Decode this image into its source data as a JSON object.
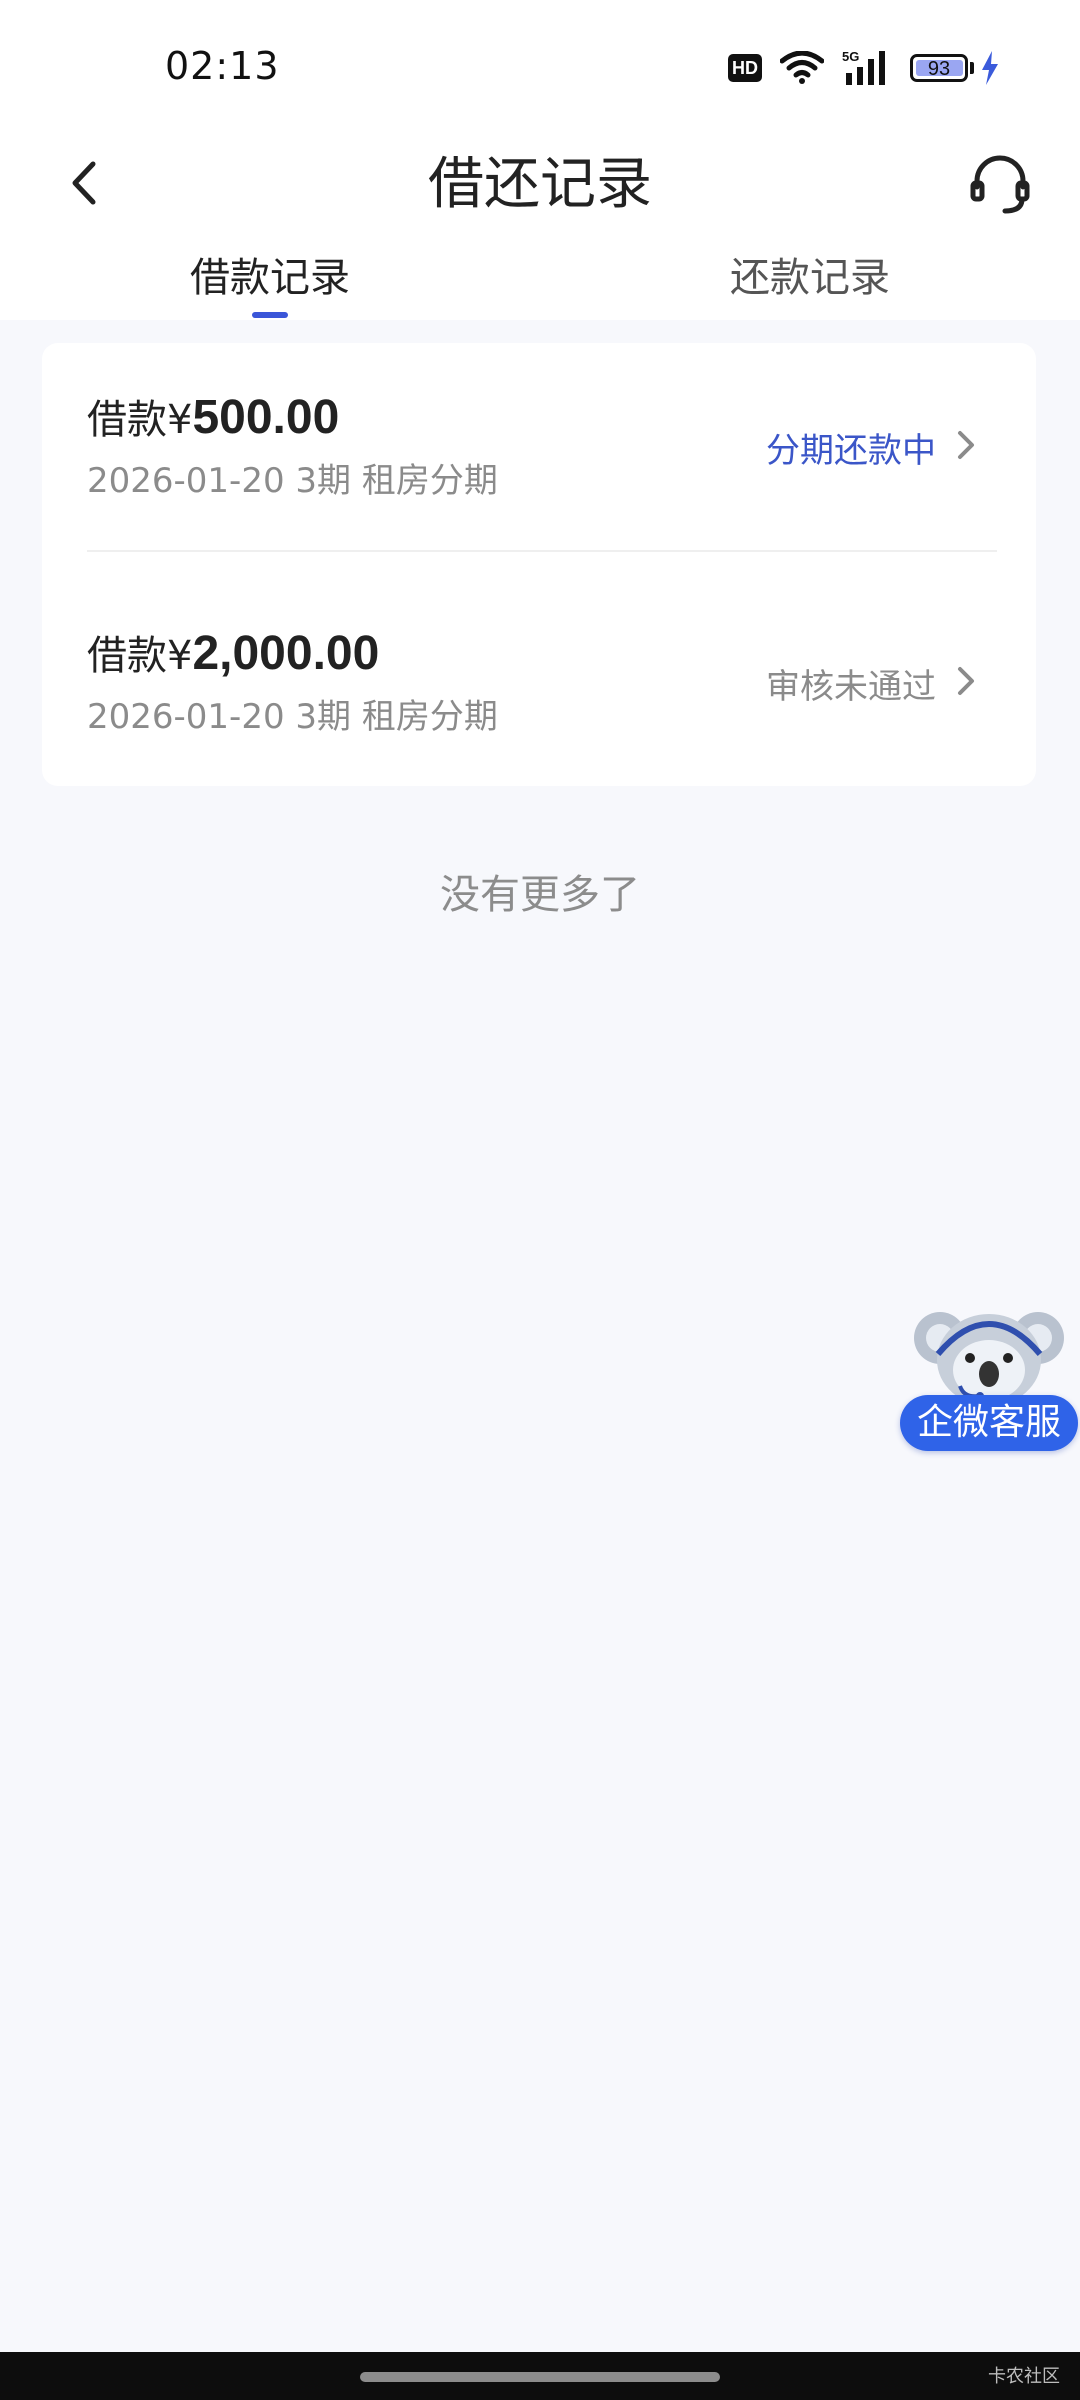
{
  "status_bar": {
    "time": "02:13",
    "battery_level": "93",
    "network": "5G",
    "icons": [
      "hd-icon",
      "wifi-icon",
      "signal-icon",
      "battery-icon",
      "charging-icon"
    ]
  },
  "header": {
    "title": "借还记录",
    "back_icon": "chevron-left-icon",
    "support_icon": "headset-icon"
  },
  "tabs": [
    {
      "label": "借款记录",
      "active": true
    },
    {
      "label": "还款记录",
      "active": false
    }
  ],
  "records": [
    {
      "title_prefix": "借款¥",
      "amount": "500.00",
      "subtitle": "2026-01-20 3期  租房分期",
      "status": "分期还款中",
      "status_color": "#3b56c8"
    },
    {
      "title_prefix": "借款¥",
      "amount": "2,000.00",
      "subtitle": "2026-01-20 3期  租房分期",
      "status": "审核未通过",
      "status_color": "#8b8b8b"
    }
  ],
  "list_end_text": "没有更多了",
  "floating_service": {
    "label": "企微客服",
    "icon": "koala-mascot-icon"
  },
  "watermark": "卡农社区",
  "colors": {
    "accent": "#3b56d8",
    "float_button": "#2f63e8",
    "background": "#f7f8fc"
  }
}
